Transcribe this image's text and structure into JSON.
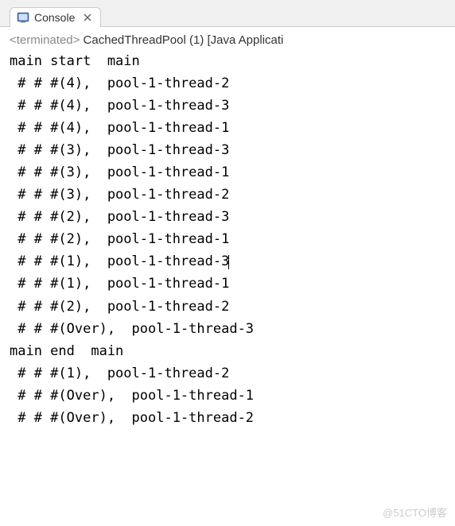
{
  "tab": {
    "label": "Console",
    "icon": "console-icon"
  },
  "status": {
    "prefix": "<terminated>",
    "text": " CachedThreadPool (1) [Java Applicati"
  },
  "lines": [
    "main start  main",
    " # # #(4),  pool-1-thread-2",
    " # # #(4),  pool-1-thread-3",
    " # # #(4),  pool-1-thread-1",
    " # # #(3),  pool-1-thread-3",
    " # # #(3),  pool-1-thread-1",
    " # # #(3),  pool-1-thread-2",
    " # # #(2),  pool-1-thread-3",
    " # # #(2),  pool-1-thread-1",
    " # # #(1),  pool-1-thread-3",
    " # # #(1),  pool-1-thread-1",
    " # # #(2),  pool-1-thread-2",
    " # # #(Over),  pool-1-thread-3",
    "main end  main",
    " # # #(1),  pool-1-thread-2",
    " # # #(Over),  pool-1-thread-1",
    " # # #(Over),  pool-1-thread-2"
  ],
  "cursor_line_index": 9,
  "watermark": "@51CTO博客"
}
